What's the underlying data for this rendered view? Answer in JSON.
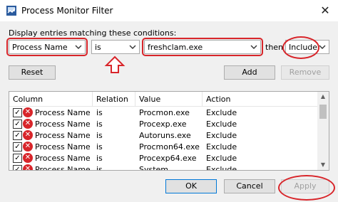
{
  "window": {
    "title": "Process Monitor Filter"
  },
  "conditions": {
    "label": "Display entries matching these conditions:",
    "column": "Process Name",
    "relation": "is",
    "value": "freshclam.exe",
    "then_label": "then",
    "action": "Include"
  },
  "buttons": {
    "reset": "Reset",
    "add": "Add",
    "remove": "Remove",
    "ok": "OK",
    "cancel": "Cancel",
    "apply": "Apply"
  },
  "table": {
    "headers": [
      "Column",
      "Relation",
      "Value",
      "Action"
    ],
    "rows": [
      {
        "checked": true,
        "column": "Process Name",
        "relation": "is",
        "value": "Procmon.exe",
        "action": "Exclude"
      },
      {
        "checked": true,
        "column": "Process Name",
        "relation": "is",
        "value": "Procexp.exe",
        "action": "Exclude"
      },
      {
        "checked": true,
        "column": "Process Name",
        "relation": "is",
        "value": "Autoruns.exe",
        "action": "Exclude"
      },
      {
        "checked": true,
        "column": "Process Name",
        "relation": "is",
        "value": "Procmon64.exe",
        "action": "Exclude"
      },
      {
        "checked": true,
        "column": "Process Name",
        "relation": "is",
        "value": "Procexp64.exe",
        "action": "Exclude"
      },
      {
        "checked": true,
        "column": "Process Name",
        "relation": "is",
        "value": "System",
        "action": "Exclude"
      }
    ]
  },
  "colors": {
    "highlight": "#d8252a",
    "exclude_icon": "#d8252a"
  }
}
